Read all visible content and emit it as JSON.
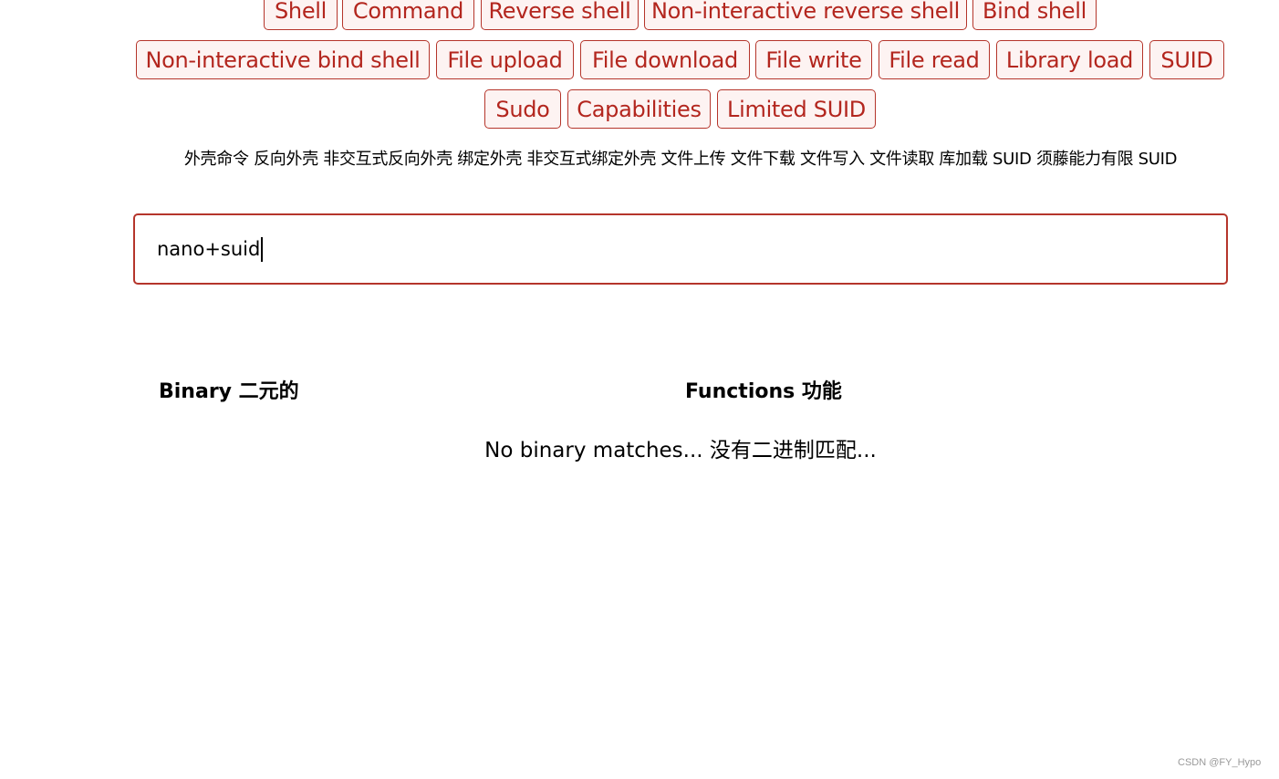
{
  "filters": {
    "row1": [
      "Shell",
      "Command",
      "Reverse shell",
      "Non-interactive reverse shell",
      "Bind shell"
    ],
    "row2": [
      "Non-interactive bind shell",
      "File upload",
      "File download",
      "File write",
      "File read",
      "Library load",
      "SUID"
    ],
    "row3": [
      "Sudo",
      "Capabilities",
      "Limited SUID"
    ]
  },
  "filters_translation": "外壳命令 反向外壳 非交互式反向外壳 绑定外壳 非交互式绑定外壳 文件上传 文件下载 文件写入 文件读取 库加载 SUID 须藤能力有限 SUID",
  "search": {
    "value": "nano+suid"
  },
  "table": {
    "headers": [
      "Binary 二元的",
      "Functions 功能"
    ],
    "empty_message": "No binary matches... 没有二进制匹配..."
  },
  "watermark": "CSDN @FY_Hypo",
  "colors": {
    "accent": "#b3261e",
    "button_bg": "#fdf3f2"
  }
}
